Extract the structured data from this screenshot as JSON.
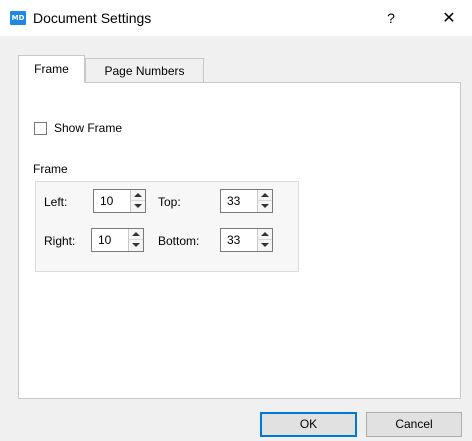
{
  "window": {
    "app_icon_text": "MD",
    "title": "Document Settings",
    "help_label": "?",
    "close_label": "✕"
  },
  "tabs": [
    {
      "label": "Frame",
      "selected": true
    },
    {
      "label": "Page Numbers",
      "selected": false
    }
  ],
  "frame_tab": {
    "show_frame": {
      "label": "Show Frame",
      "checked": false
    },
    "group_title": "Frame",
    "fields": {
      "left": {
        "label": "Left:",
        "value": "10"
      },
      "top": {
        "label": "Top:",
        "value": "33"
      },
      "right": {
        "label": "Right:",
        "value": "10"
      },
      "bottom": {
        "label": "Bottom:",
        "value": "33"
      }
    }
  },
  "buttons": {
    "ok": "OK",
    "cancel": "Cancel"
  },
  "colors": {
    "accent": "#0078d7",
    "app_icon": "#1e88e5"
  }
}
